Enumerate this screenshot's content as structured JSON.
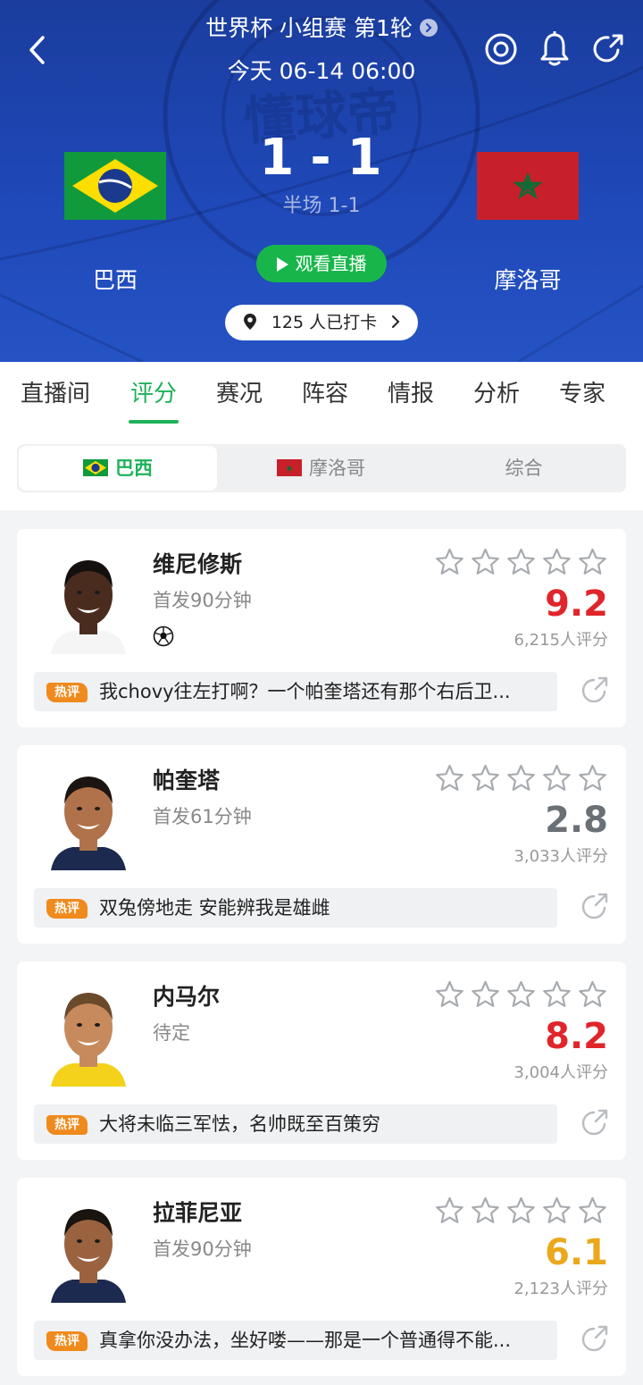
{
  "header": {
    "title": "世界杯 小组赛 第1轮",
    "time": "今天 06-14 06:00",
    "watermark": "懂球帝",
    "home_team": "巴西",
    "away_team": "摩洛哥",
    "home_score": "1",
    "separator": "-",
    "away_score": "1",
    "halftime": "半场 1-1",
    "live_label": "观看直播",
    "checkin_label": "125 人已打卡",
    "icons": [
      "back-icon",
      "target-icon",
      "bell-icon",
      "share-icon"
    ]
  },
  "tabs": [
    "直播间",
    "评分",
    "赛况",
    "阵容",
    "情报",
    "分析",
    "专家"
  ],
  "active_tab": "评分",
  "segments": [
    "巴西",
    "摩洛哥",
    "综合"
  ],
  "active_segment": "巴西",
  "colors": {
    "accent_green": "#1fb25a",
    "rating_red": "#e0252b",
    "rating_gray": "#6b7076",
    "rating_yellow": "#eaa81c",
    "header_blue": "#1f48b8",
    "hot_badge": "#f08a1c"
  },
  "players": [
    {
      "name": "维尼修斯",
      "status": "首发90分钟",
      "goal_icon": true,
      "stars": 5,
      "rating": "9.2",
      "rating_color": "#e0252b",
      "votes": "6,215人评分",
      "hot_label": "热评",
      "comment": "我chovy往左打啊？一个帕奎塔还有那个右后卫..."
    },
    {
      "name": "帕奎塔",
      "status": "首发61分钟",
      "goal_icon": false,
      "stars": 5,
      "rating": "2.8",
      "rating_color": "#6b7076",
      "votes": "3,033人评分",
      "hot_label": "热评",
      "comment": "双兔傍地走 安能辨我是雄雌"
    },
    {
      "name": "内马尔",
      "status": "待定",
      "goal_icon": false,
      "stars": 5,
      "rating": "8.2",
      "rating_color": "#e0252b",
      "votes": "3,004人评分",
      "hot_label": "热评",
      "comment": "大将未临三军怯，名帅既至百策穷"
    },
    {
      "name": "拉菲尼亚",
      "status": "首发90分钟",
      "goal_icon": false,
      "stars": 5,
      "rating": "6.1",
      "rating_color": "#eaa81c",
      "votes": "2,123人评分",
      "hot_label": "热评",
      "comment": "真拿你没办法，坐好喽——那是一个普通得不能..."
    }
  ]
}
